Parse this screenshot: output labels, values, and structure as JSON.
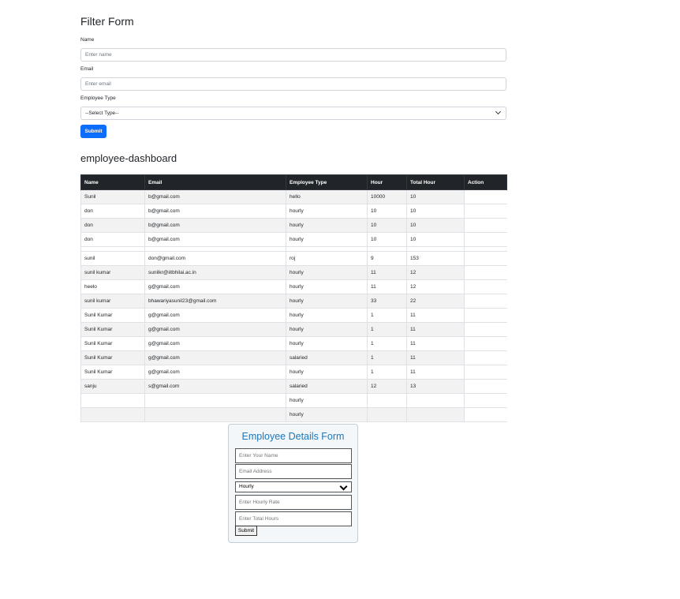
{
  "filter_form": {
    "title": "Filter Form",
    "name_label": "Name",
    "name_placeholder": "Enter name",
    "email_label": "Email",
    "email_placeholder": "Enter email",
    "type_label": "Employee Type",
    "type_selected": "--Select Type--",
    "submit_label": "Submit"
  },
  "dashboard": {
    "title": "employee-dashboard",
    "columns": [
      "Name",
      "Email",
      "Employee Type",
      "Hour",
      "Total Hour",
      "Action"
    ],
    "rows": [
      [
        "Sunil",
        "b@gmail.com",
        "hello",
        "10000",
        "10",
        ""
      ],
      [
        "don",
        "b@gmail.com",
        "hourly",
        "10",
        "10",
        ""
      ],
      [
        "don",
        "b@gmail.com",
        "hourly",
        "10",
        "10",
        ""
      ],
      [
        "don",
        "b@gmail.com",
        "hourly",
        "10",
        "10",
        ""
      ],
      [
        "",
        "",
        "",
        "",
        "",
        ""
      ],
      [
        "sunil",
        "don@gmail.com",
        "roj",
        "9",
        "153",
        ""
      ],
      [
        "sunil kumar",
        "sunilkr@iitbhilai.ac.in",
        "hourly",
        "11",
        "12",
        ""
      ],
      [
        "heelo",
        "g@gmail.com",
        "hourly",
        "11",
        "12",
        ""
      ],
      [
        "sunil kumar",
        "bhawariyasunil23@gmail.com",
        "hourly",
        "33",
        "22",
        ""
      ],
      [
        "Sunil Kumar",
        "g@gmail.com",
        "hourly",
        "1",
        "11",
        ""
      ],
      [
        "Sunil Kumar",
        "g@gmail.com",
        "hourly",
        "1",
        "11",
        ""
      ],
      [
        "Sunil Kumar",
        "g@gmail.com",
        "hourly",
        "1",
        "11",
        ""
      ],
      [
        "Sunil Kumar",
        "g@gmail.com",
        "salaried",
        "1",
        "11",
        ""
      ],
      [
        "Sunil Kumar",
        "g@gmail.com",
        "hourly",
        "1",
        "11",
        ""
      ],
      [
        "sanju",
        "s@gmail.com",
        "salaried",
        "12",
        "13",
        ""
      ],
      [
        "",
        "",
        "hourly",
        "",
        "",
        ""
      ],
      [
        "",
        "",
        "hourly",
        "",
        "",
        ""
      ]
    ]
  },
  "details_form": {
    "title": "Employee Details Form",
    "name_placeholder": "Enter Your Name",
    "email_placeholder": "Email Address",
    "type_selected": "Hourly",
    "rate_placeholder": "Enter Hourly Rate",
    "hours_placeholder": "Enter Total Hours",
    "submit_label": "Submit"
  },
  "colors": {
    "primary_button": "#0d6efd",
    "table_header": "#212529",
    "form_title": "#1b76ba"
  }
}
